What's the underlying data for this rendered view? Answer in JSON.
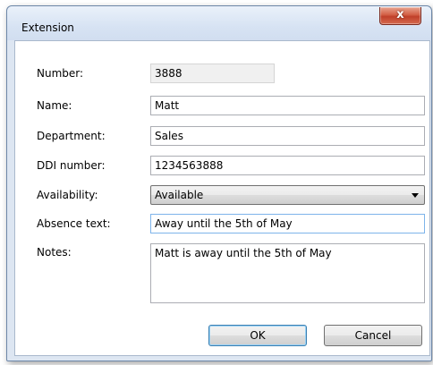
{
  "window": {
    "title": "Extension",
    "close_label": "x"
  },
  "form": {
    "number_label": "Number:",
    "number_value": "3888",
    "name_label": "Name:",
    "name_value": "Matt",
    "department_label": "Department:",
    "department_value": "Sales",
    "ddi_label": "DDI number:",
    "ddi_value": "1234563888",
    "availability_label": "Availability:",
    "availability_value": "Available",
    "absence_label": "Absence text:",
    "absence_value": "Away until the 5th of May",
    "notes_label": "Notes:",
    "notes_value": "Matt is away until the 5th of May"
  },
  "buttons": {
    "ok_label": "OK",
    "cancel_label": "Cancel"
  }
}
